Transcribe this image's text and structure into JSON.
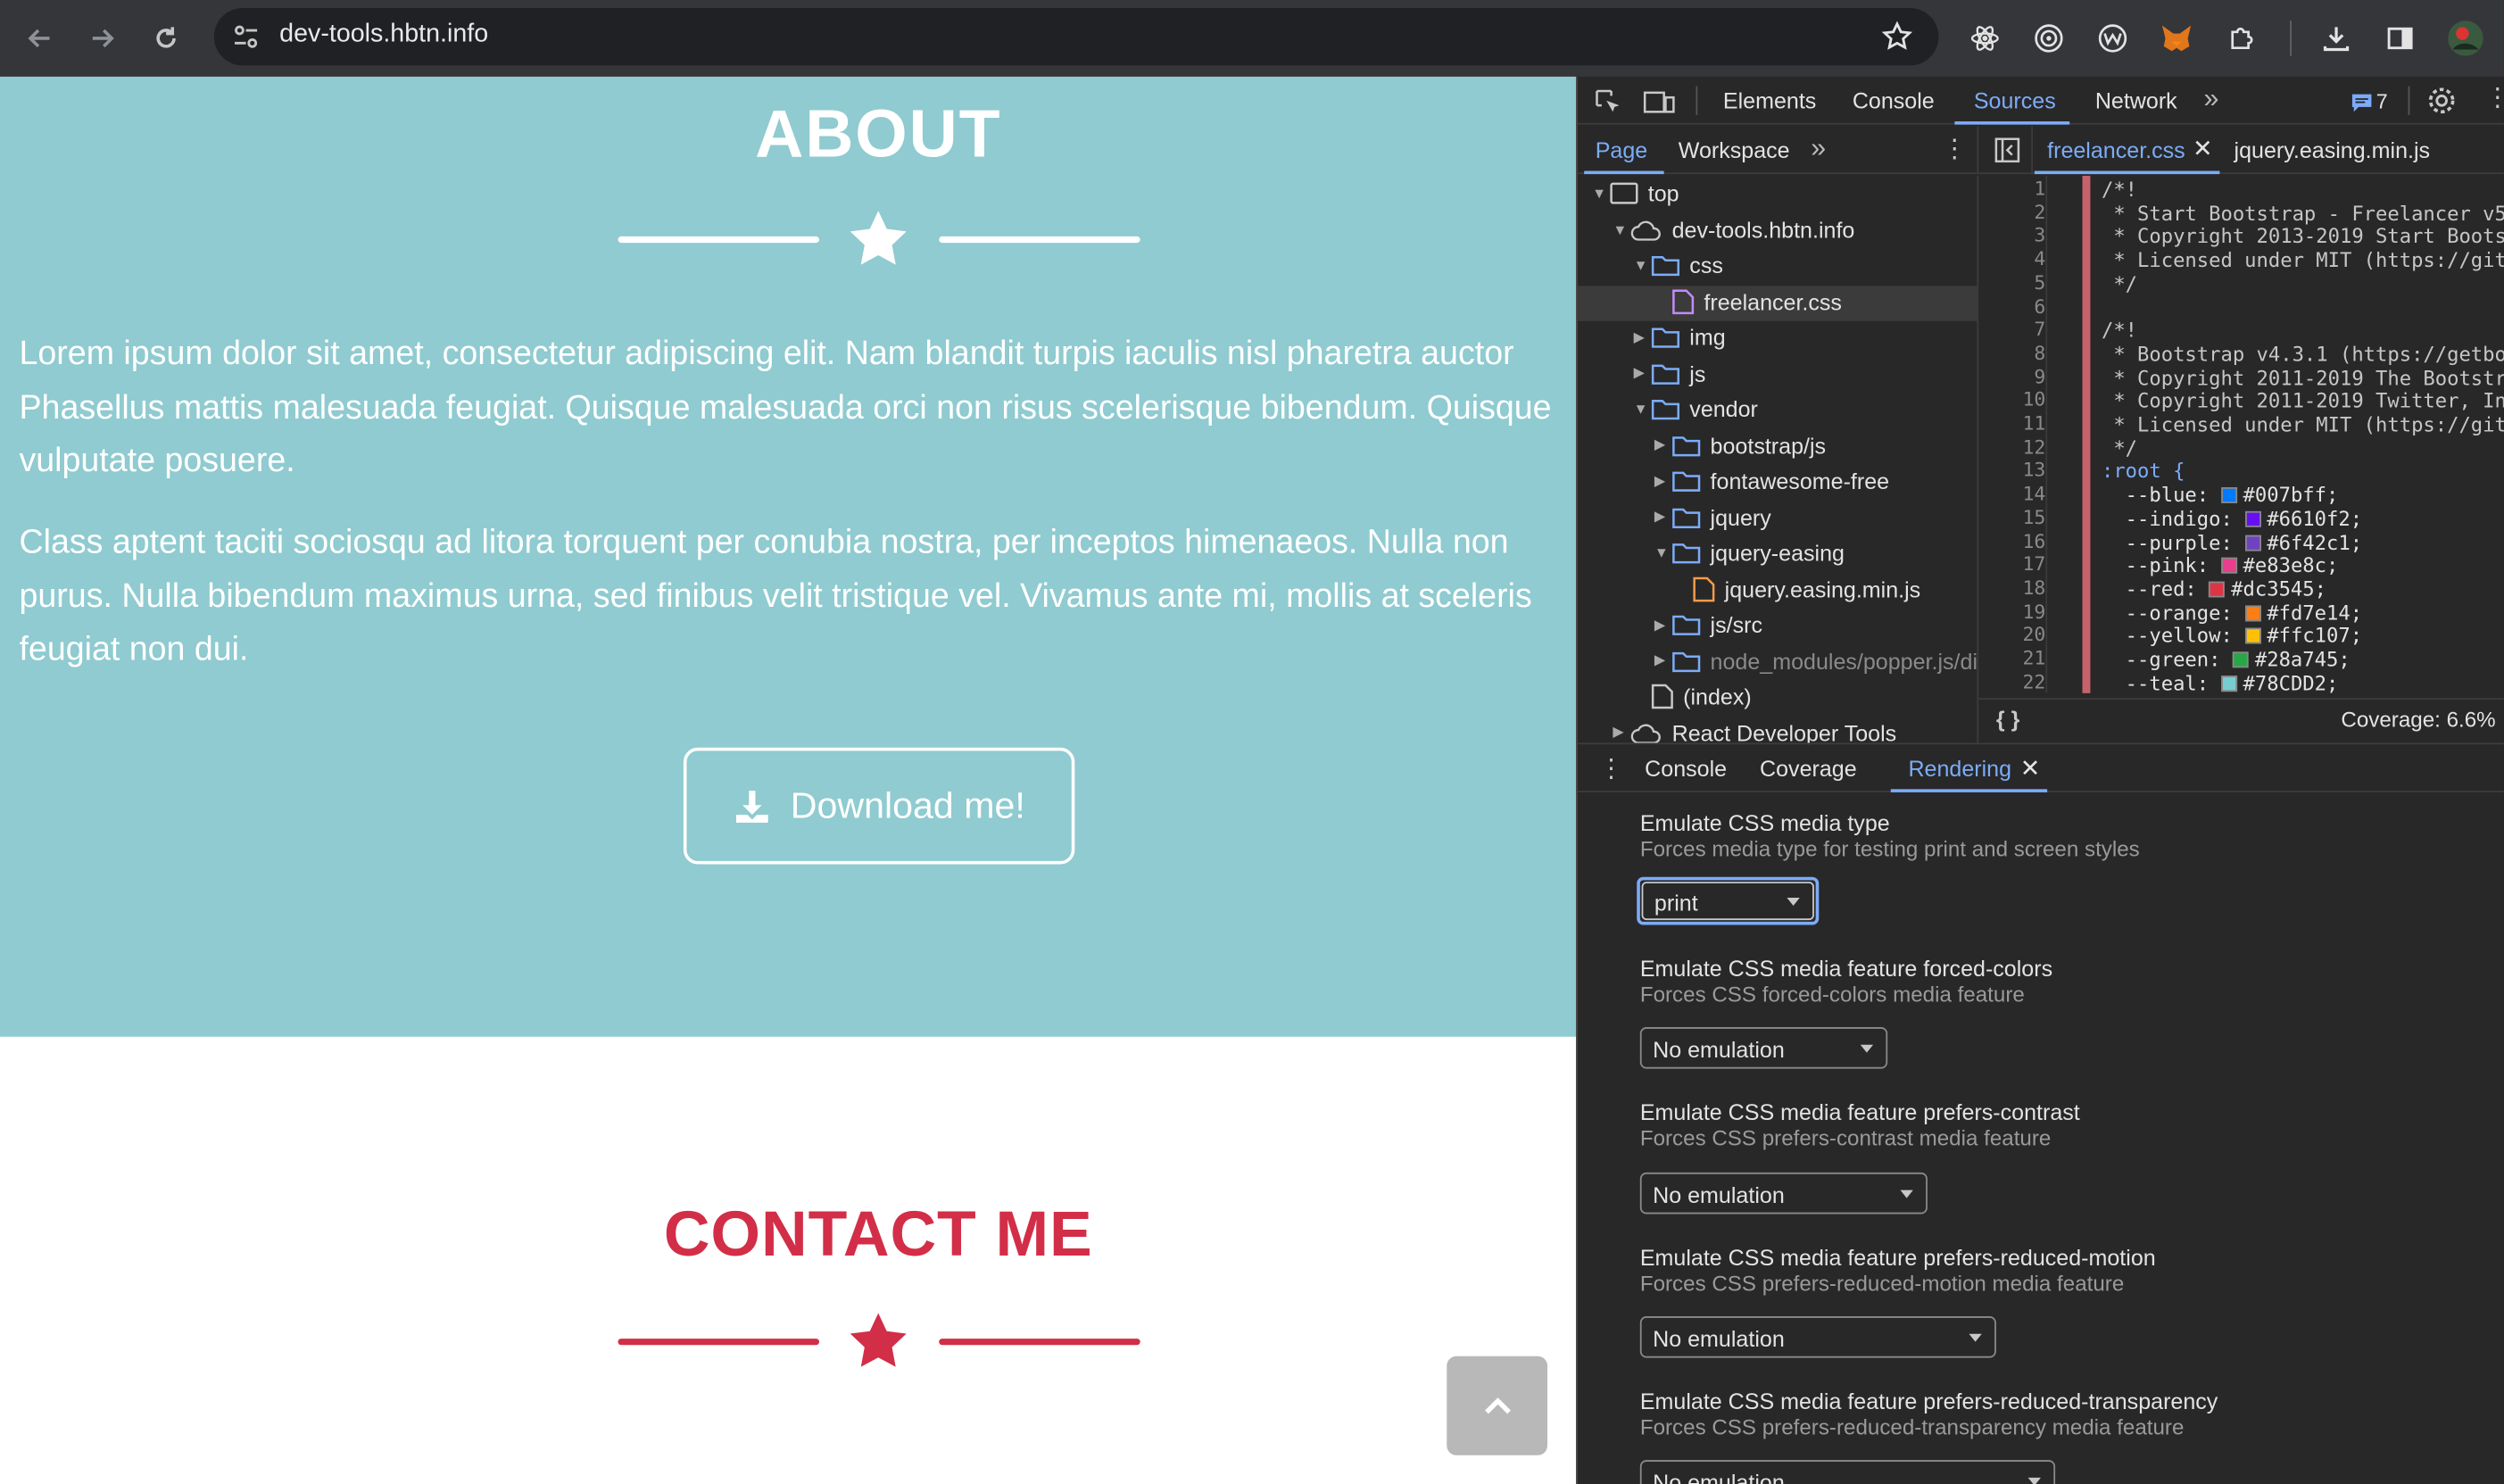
{
  "browser": {
    "url": "dev-tools.hbtn.info"
  },
  "page": {
    "about_title": "ABOUT",
    "about_para1": [
      "Lorem ipsum dolor sit amet, consectetur adipiscing elit. Nam blandit turpis iaculis nisl pharetra auctor",
      "Phasellus mattis malesuada feugiat. Quisque malesuada orci non risus scelerisque bibendum. Quisque",
      "vulputate posuere."
    ],
    "about_para2": [
      "Class aptent taciti sociosqu ad litora torquent per conubia nostra, per inceptos himenaeos. Nulla non",
      "purus. Nulla bibendum maximus urna, sed finibus velit tristique vel. Vivamus ante mi, mollis at sceleris",
      "feugiat non dui."
    ],
    "download_label": "Download me!",
    "contact_title": "CONTACT ME",
    "colors": {
      "about_bg": "#8fcbd0",
      "contact_accent": "#d22e48"
    }
  },
  "devtools": {
    "main_tabs": [
      "Elements",
      "Console",
      "Sources",
      "Network"
    ],
    "active_main_tab": "Sources",
    "issues_count": "7",
    "nav_tabs": [
      "Page",
      "Workspace"
    ],
    "tree": [
      {
        "label": "top",
        "icon": "frame-icon"
      },
      {
        "label": "dev-tools.hbtn.info",
        "icon": "cloud-icon"
      },
      {
        "label": "css",
        "icon": "folder-icon"
      },
      {
        "label": "freelancer.css",
        "icon": "file-css-icon"
      },
      {
        "label": "img",
        "icon": "folder-icon"
      },
      {
        "label": "js",
        "icon": "folder-icon"
      },
      {
        "label": "vendor",
        "icon": "folder-icon"
      },
      {
        "label": "bootstrap/js",
        "icon": "folder-icon"
      },
      {
        "label": "fontawesome-free",
        "icon": "folder-icon"
      },
      {
        "label": "jquery",
        "icon": "folder-icon"
      },
      {
        "label": "jquery-easing",
        "icon": "folder-icon"
      },
      {
        "label": "jquery.easing.min.js",
        "icon": "file-js-icon"
      },
      {
        "label": "js/src",
        "icon": "folder-icon"
      },
      {
        "label": "node_modules/popper.js/di",
        "icon": "folder-icon"
      },
      {
        "label": "(index)",
        "icon": "file-icon"
      },
      {
        "label": "React Developer Tools",
        "icon": "cloud-icon"
      }
    ],
    "editor_tabs": [
      "freelancer.css",
      "jquery.easing.min.js"
    ],
    "line_numbers": [
      "1",
      "2",
      "3",
      "4",
      "5",
      "6",
      "7",
      "8",
      "9",
      "10",
      "11",
      "12",
      "13",
      "14",
      "15",
      "16",
      "17",
      "18",
      "19",
      "20",
      "21",
      "22"
    ],
    "code_lines": [
      "/*!",
      " * Start Bootstrap - Freelancer v5",
      " * Copyright 2013-2019 Start Boots",
      " * Licensed under MIT (https://git",
      " */",
      "",
      "/*!",
      " * Bootstrap v4.3.1 (https://getbo",
      " * Copyright 2011-2019 The Bootstr",
      " * Copyright 2011-2019 Twitter, In",
      " * Licensed under MIT (https://git",
      " */"
    ],
    "root_selector": ":root {",
    "css_vars": [
      {
        "name": "  --blue: ",
        "value": "#007bff;",
        "color": "#007bff"
      },
      {
        "name": "  --indigo: ",
        "value": "#6610f2;",
        "color": "#6610f2"
      },
      {
        "name": "  --purple: ",
        "value": "#6f42c1;",
        "color": "#6f42c1"
      },
      {
        "name": "  --pink: ",
        "value": "#e83e8c;",
        "color": "#e83e8c"
      },
      {
        "name": "  --red: ",
        "value": "#dc3545;",
        "color": "#dc3545"
      },
      {
        "name": "  --orange: ",
        "value": "#fd7e14;",
        "color": "#fd7e14"
      },
      {
        "name": "  --yellow: ",
        "value": "#ffc107;",
        "color": "#ffc107"
      },
      {
        "name": "  --green: ",
        "value": "#28a745;",
        "color": "#28a745"
      },
      {
        "name": "  --teal: ",
        "value": "#78CDD2;",
        "color": "#78CDD2"
      }
    ],
    "coverage": "Coverage: 6.6%",
    "drawer_tabs": [
      "Console",
      "Coverage",
      "Rendering"
    ],
    "active_drawer_tab": "Rendering",
    "rendering": [
      {
        "title": "Emulate CSS media type",
        "subtitle": "Forces media type for testing print and screen styles",
        "value": "print"
      },
      {
        "title": "Emulate CSS media feature forced-colors",
        "subtitle": "Forces CSS forced-colors media feature",
        "value": "No emulation"
      },
      {
        "title": "Emulate CSS media feature prefers-contrast",
        "subtitle": "Forces CSS prefers-contrast media feature",
        "value": "No emulation"
      },
      {
        "title": "Emulate CSS media feature prefers-reduced-motion",
        "subtitle": "Forces CSS prefers-reduced-motion media feature",
        "value": "No emulation"
      },
      {
        "title": "Emulate CSS media feature prefers-reduced-transparency",
        "subtitle": "Forces CSS prefers-reduced-transparency media feature",
        "value": "No emulation"
      }
    ]
  }
}
